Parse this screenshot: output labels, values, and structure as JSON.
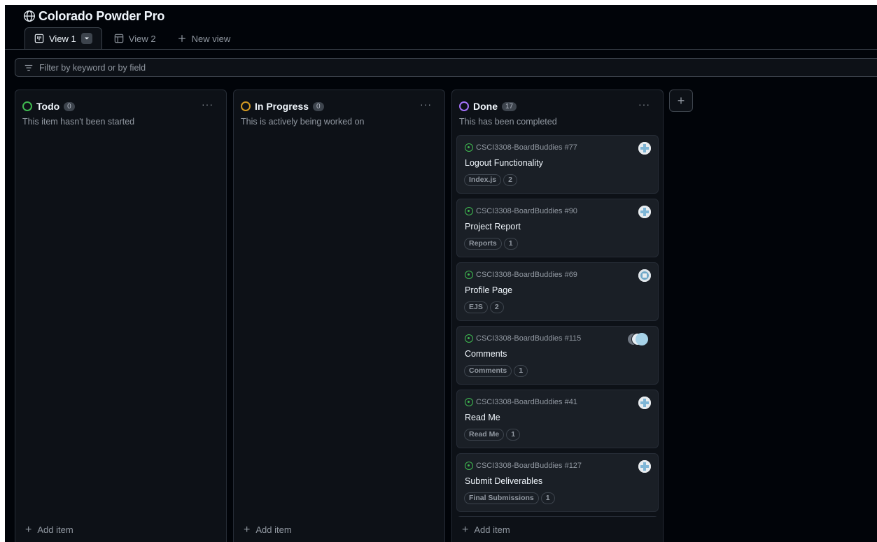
{
  "project": {
    "title": "Colorado Powder Pro"
  },
  "tabs": [
    {
      "label": "View 1",
      "active": true,
      "icon": "board-icon"
    },
    {
      "label": "View 2",
      "active": false,
      "icon": "table-icon"
    },
    {
      "label": "New view",
      "icon": "plus-icon"
    }
  ],
  "filter": {
    "placeholder": "Filter by keyword or by field"
  },
  "columns": [
    {
      "name": "Todo",
      "count": "0",
      "description": "This item hasn't been started",
      "status_color": "#3fb950",
      "add_label": "Add item"
    },
    {
      "name": "In Progress",
      "count": "0",
      "description": "This is actively being worked on",
      "status_color": "#d29922",
      "add_label": "Add item"
    },
    {
      "name": "Done",
      "count": "17",
      "description": "This has been completed",
      "status_color": "#a371f7",
      "add_label": "Add item"
    }
  ],
  "cards": [
    {
      "repo": "CSCI3308-BoardBuddies #77",
      "title": "Logout Functionality",
      "labels": [
        "Index.js",
        "2"
      ]
    },
    {
      "repo": "CSCI3308-BoardBuddies #90",
      "title": "Project Report",
      "labels": [
        "Reports",
        "1"
      ]
    },
    {
      "repo": "CSCI3308-BoardBuddies #69",
      "title": "Profile Page",
      "labels": [
        "EJS",
        "2"
      ]
    },
    {
      "repo": "CSCI3308-BoardBuddies #115",
      "title": "Comments",
      "labels": [
        "Comments",
        "1"
      ]
    },
    {
      "repo": "CSCI3308-BoardBuddies #41",
      "title": "Read Me",
      "labels": [
        "Read Me",
        "1"
      ]
    },
    {
      "repo": "CSCI3308-BoardBuddies #127",
      "title": "Submit Deliverables",
      "labels": [
        "Final Submissions",
        "1"
      ]
    }
  ],
  "colors": {
    "background": "#010409",
    "panel": "#0d1117",
    "card": "#1a1f26",
    "border": "#3d444d",
    "muted_text": "#9198a1",
    "text": "#f0f6fc"
  }
}
